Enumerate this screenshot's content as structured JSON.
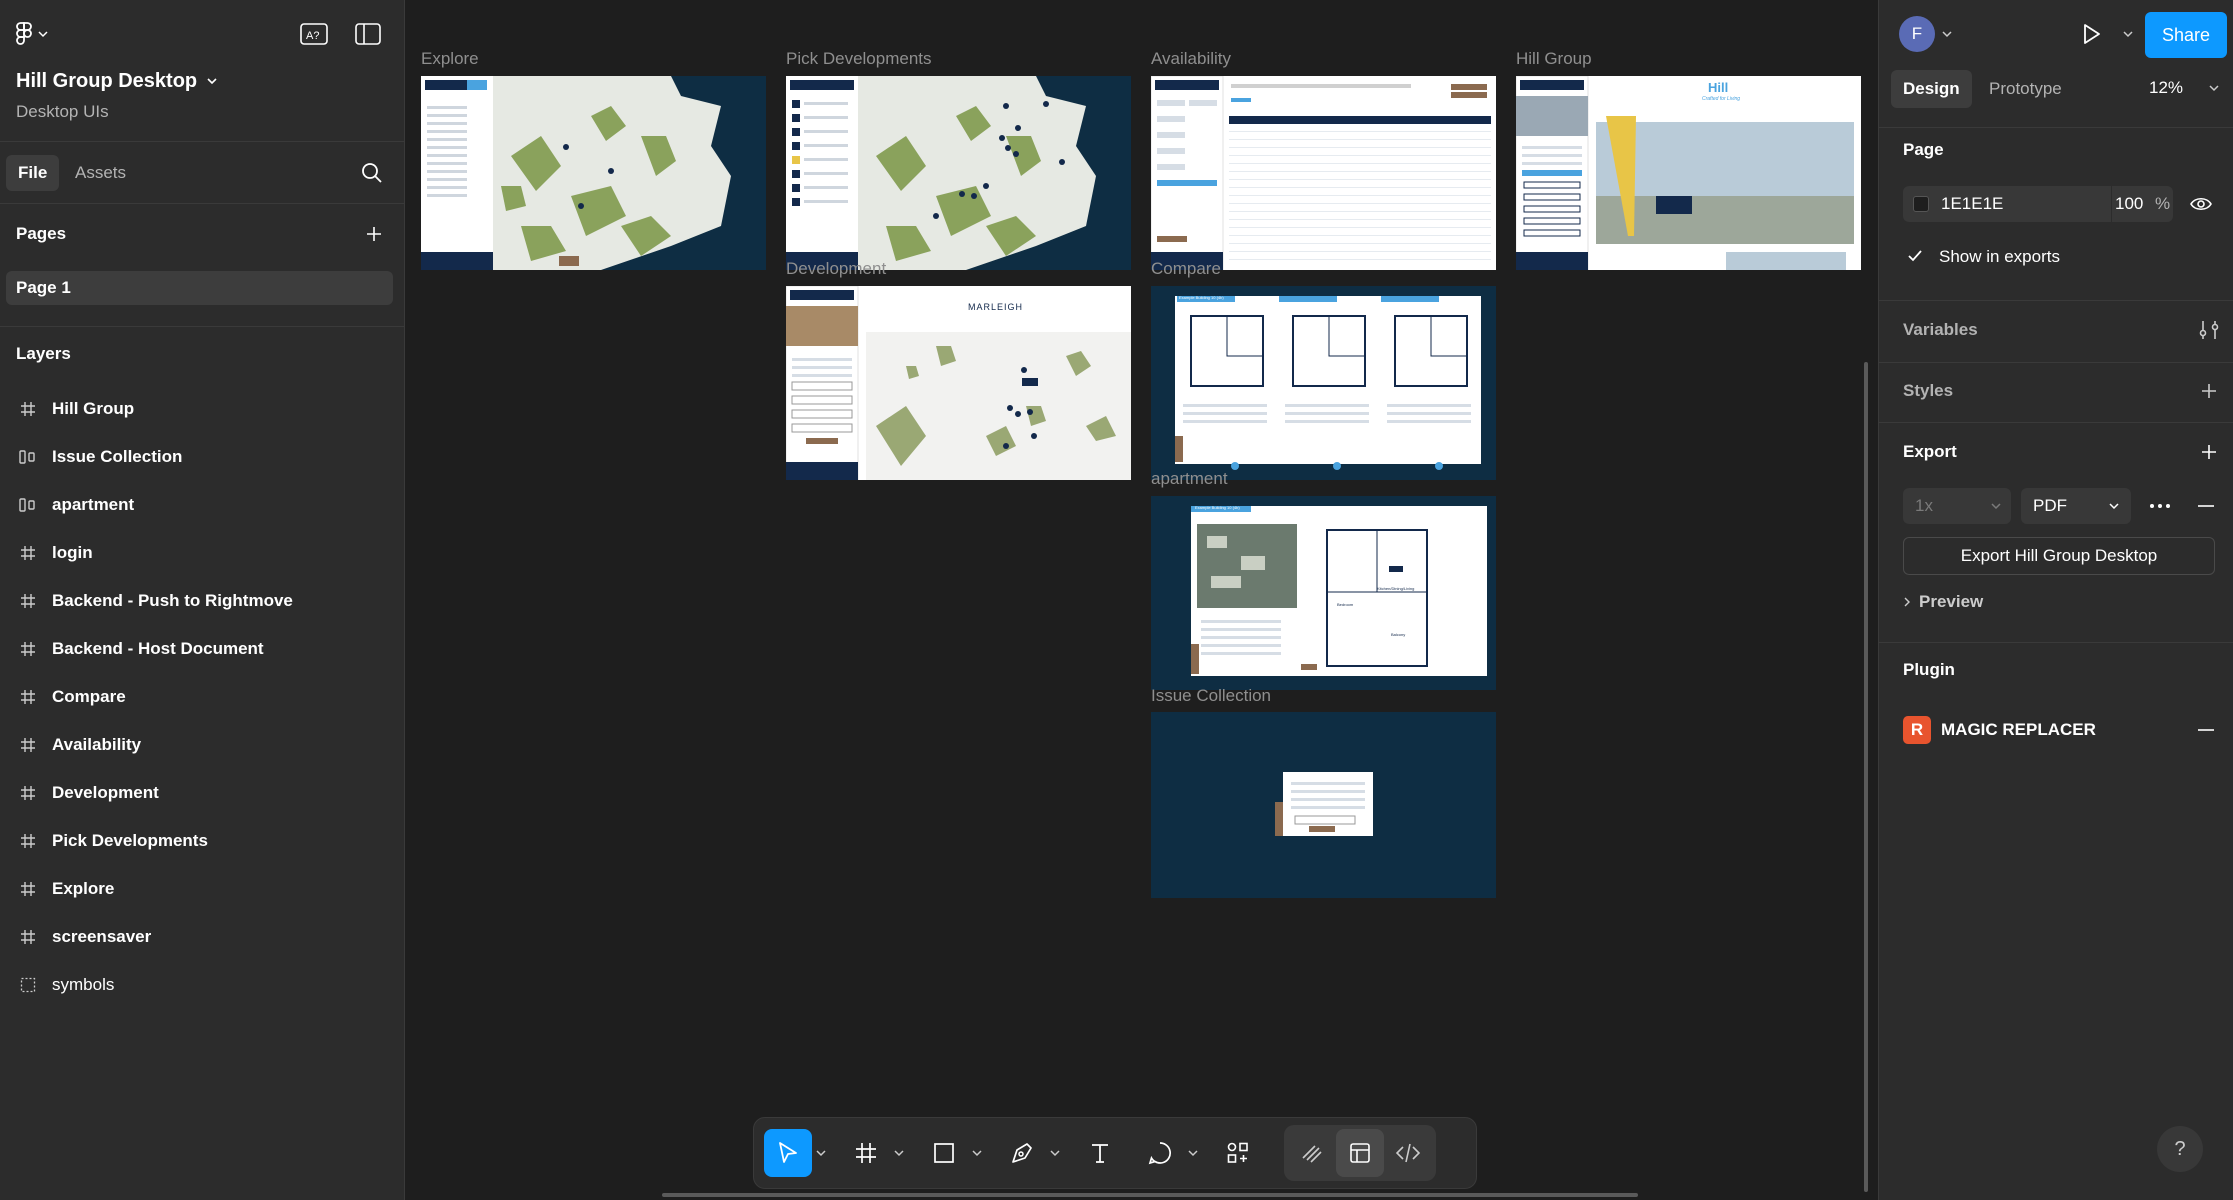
{
  "file": {
    "title": "Hill Group Desktop",
    "subtitle": "Desktop UIs"
  },
  "left_tabs": {
    "file": "File",
    "assets": "Assets"
  },
  "pages": {
    "heading": "Pages",
    "items": [
      "Page 1"
    ]
  },
  "layers": {
    "heading": "Layers",
    "items": [
      {
        "name": "Hill Group",
        "icon": "frame-icon"
      },
      {
        "name": "Issue Collection",
        "icon": "auto-layout-icon"
      },
      {
        "name": "apartment",
        "icon": "auto-layout-icon"
      },
      {
        "name": "login",
        "icon": "frame-icon"
      },
      {
        "name": "Backend - Push to Rightmove",
        "icon": "frame-icon"
      },
      {
        "name": "Backend - Host Document",
        "icon": "frame-icon"
      },
      {
        "name": "Compare",
        "icon": "frame-icon"
      },
      {
        "name": "Availability",
        "icon": "frame-icon"
      },
      {
        "name": "Development",
        "icon": "frame-icon"
      },
      {
        "name": "Pick Developments",
        "icon": "frame-icon"
      },
      {
        "name": "Explore",
        "icon": "frame-icon"
      },
      {
        "name": "screensaver",
        "icon": "frame-icon"
      },
      {
        "name": "symbols",
        "icon": "section-icon"
      }
    ]
  },
  "canvas": {
    "frames": {
      "explore": "Explore",
      "pick": "Pick Developments",
      "availability": "Availability",
      "hill": "Hill Group",
      "development": "Development",
      "compare": "Compare",
      "apartment": "apartment",
      "issue": "Issue Collection"
    },
    "thumb_text": {
      "hill_logo": "Hill",
      "hill_tagline": "Crafted for Living",
      "marleigh": "MARLEIGH",
      "compare_card": "Example Building 10 (4b)",
      "apartment_card": "Example Building 10 (4b)",
      "floor_bedroom": "Bedroom",
      "floor_kitchen": "Kitchen/Dining/Living",
      "floor_balcony": "Balcony"
    }
  },
  "user": {
    "initial": "F"
  },
  "share_label": "Share",
  "right_tabs": {
    "design": "Design",
    "prototype": "Prototype"
  },
  "zoom": "12%",
  "page_section": {
    "heading": "Page",
    "color_hex": "1E1E1E",
    "opacity": "100",
    "opacity_unit": "%",
    "show_in_exports": "Show in exports"
  },
  "variables_label": "Variables",
  "styles_label": "Styles",
  "export": {
    "heading": "Export",
    "scale": "1x",
    "format": "PDF",
    "button": "Export Hill Group Desktop",
    "preview": "Preview"
  },
  "plugin": {
    "heading": "Plugin",
    "icon_letter": "R",
    "name": "MAGIC REPLACER"
  },
  "help": "?",
  "colors": {
    "accent": "#0d99ff",
    "map_sea": "#0e2d43",
    "map_land": "#8aa25c",
    "brand_navy": "#13294b",
    "brand_brown": "#8b6a4f"
  }
}
